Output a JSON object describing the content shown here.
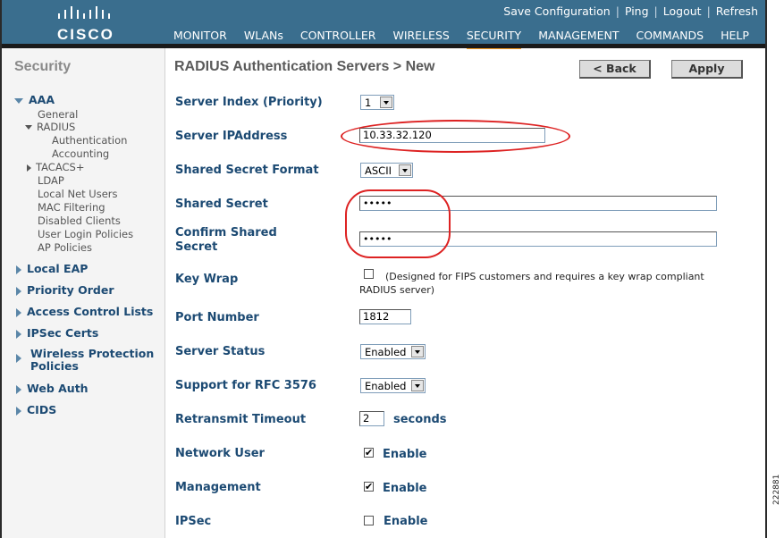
{
  "header": {
    "logo_text": "CISCO",
    "top_links": [
      "Save Configuration",
      "Ping",
      "Logout",
      "Refresh"
    ],
    "nav": [
      "MONITOR",
      "WLANs",
      "CONTROLLER",
      "WIRELESS",
      "SECURITY",
      "MANAGEMENT",
      "COMMANDS",
      "HELP"
    ],
    "active_nav": "SECURITY"
  },
  "sidebar": {
    "title": "Security",
    "aaa": {
      "label": "AAA",
      "general": "General",
      "radius": "RADIUS",
      "authentication": "Authentication",
      "accounting": "Accounting",
      "tacacs": "TACACS+",
      "ldap": "LDAP",
      "local_net_users": "Local Net Users",
      "mac_filtering": "MAC Filtering",
      "disabled_clients": "Disabled Clients",
      "user_login_policies": "User Login Policies",
      "ap_policies": "AP Policies"
    },
    "sections": [
      "Local EAP",
      "Priority Order",
      "Access Control Lists",
      "IPSec Certs",
      "Wireless Protection Policies",
      "Web Auth",
      "CIDS"
    ]
  },
  "page": {
    "title": "RADIUS Authentication Servers > New",
    "back_label": "< Back",
    "apply_label": "Apply"
  },
  "form": {
    "server_index_label": "Server Index (Priority)",
    "server_index_value": "1",
    "server_ip_label": "Server IPAddress",
    "server_ip_value": "10.33.32.120",
    "secret_format_label": "Shared Secret Format",
    "secret_format_value": "ASCII",
    "shared_secret_label": "Shared Secret",
    "shared_secret_value": "•••••",
    "confirm_secret_label": "Confirm Shared Secret",
    "confirm_secret_value": "•••••",
    "key_wrap_label": "Key Wrap",
    "key_wrap_note_1": "(Designed for FIPS customers and requires a key wrap compliant",
    "key_wrap_note_2": "RADIUS server)",
    "port_label": "Port Number",
    "port_value": "1812",
    "status_label": "Server Status",
    "status_value": "Enabled",
    "rfc_label": "Support for RFC 3576",
    "rfc_value": "Enabled",
    "timeout_label": "Retransmit Timeout",
    "timeout_value": "2",
    "timeout_unit": "seconds",
    "network_user_label": "Network User",
    "management_label": "Management",
    "ipsec_label": "IPSec",
    "enable_text": "Enable",
    "network_user_checked": true,
    "management_checked": true,
    "ipsec_checked": false,
    "key_wrap_checked": false
  },
  "figure_id": "222881",
  "colors": {
    "header": "#3a6e8e",
    "active_underline": "#f29b21",
    "label": "#1c4a73",
    "annotation": "#dd2222"
  }
}
